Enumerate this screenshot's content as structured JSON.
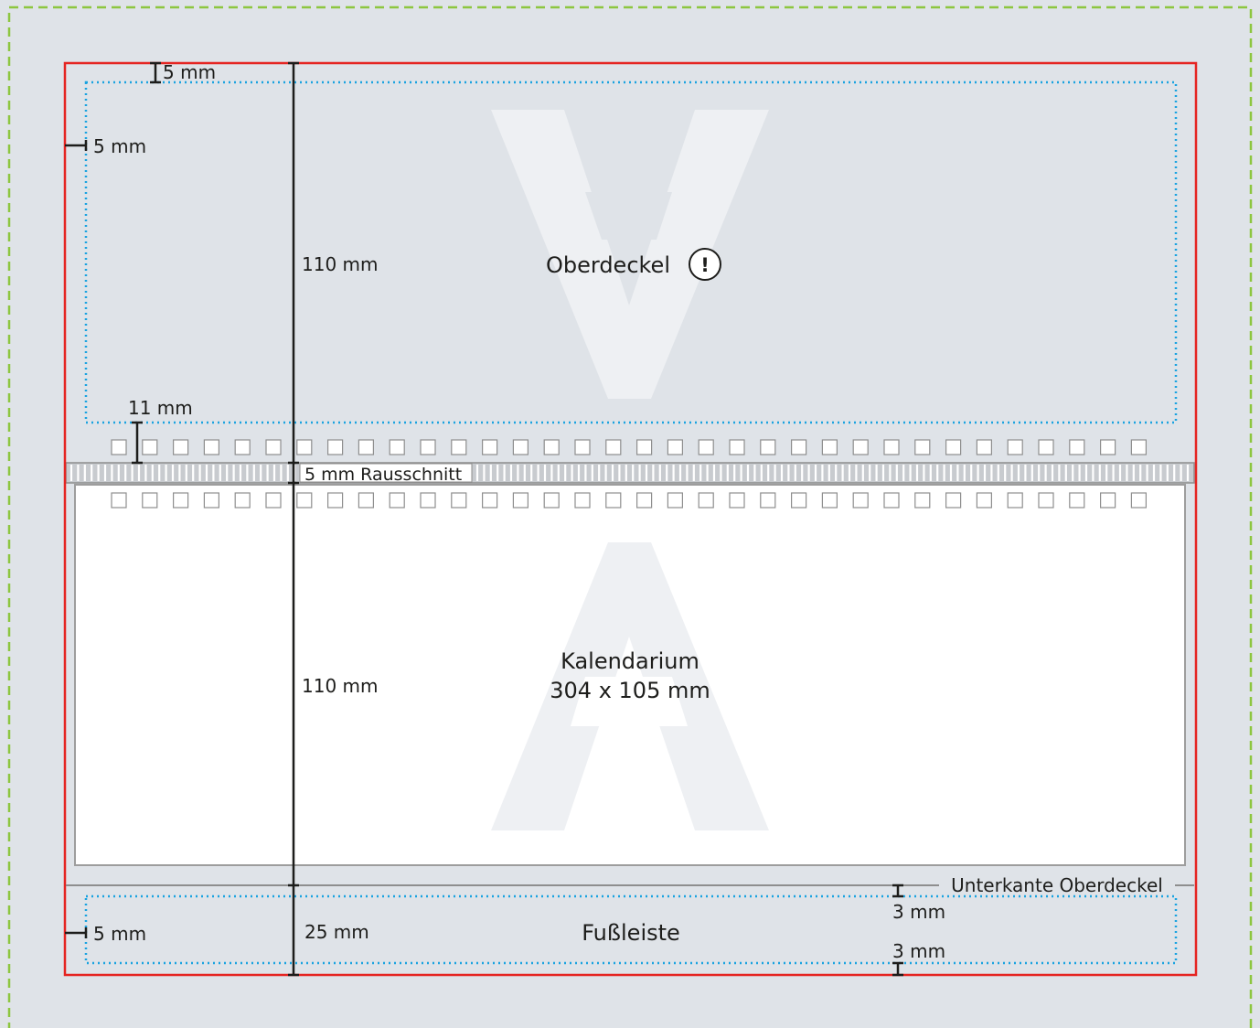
{
  "colors": {
    "background": "#dfe3e8",
    "bleed_line": "#8dc63f",
    "trim_line": "#e52421",
    "safe_line": "#1aa3e0",
    "calendar_fill": "#ffffff",
    "calendar_border": "#9d9d9d",
    "strip_fill": "#c8cbcf",
    "watermark": "#eef0f3",
    "dimension": "#1d1d1b"
  },
  "labels": {
    "margin_top": "5 mm",
    "margin_left_top": "5 mm",
    "cover_height": "110 mm",
    "cover_gap": "11 mm",
    "cut_strip": "5 mm Rausschnitt",
    "calendar_height": "110 mm",
    "footer_height": "25 mm",
    "margin_left_footer": "5 mm",
    "footer_top_margin": "3 mm",
    "footer_bottom_margin": "3 mm",
    "lower_edge_label": "Unterkante Oberdeckel"
  },
  "sections": {
    "cover": {
      "title": "Oberdeckel",
      "warning_symbol": "!",
      "watermark_letter": "A"
    },
    "calendar": {
      "title_line1": "Kalendarium",
      "title_line2": "304 x 105 mm",
      "watermark_letter": "A"
    },
    "footer": {
      "title": "Fußleiste"
    }
  },
  "icons": {
    "warning": "exclamation-circle-icon"
  }
}
